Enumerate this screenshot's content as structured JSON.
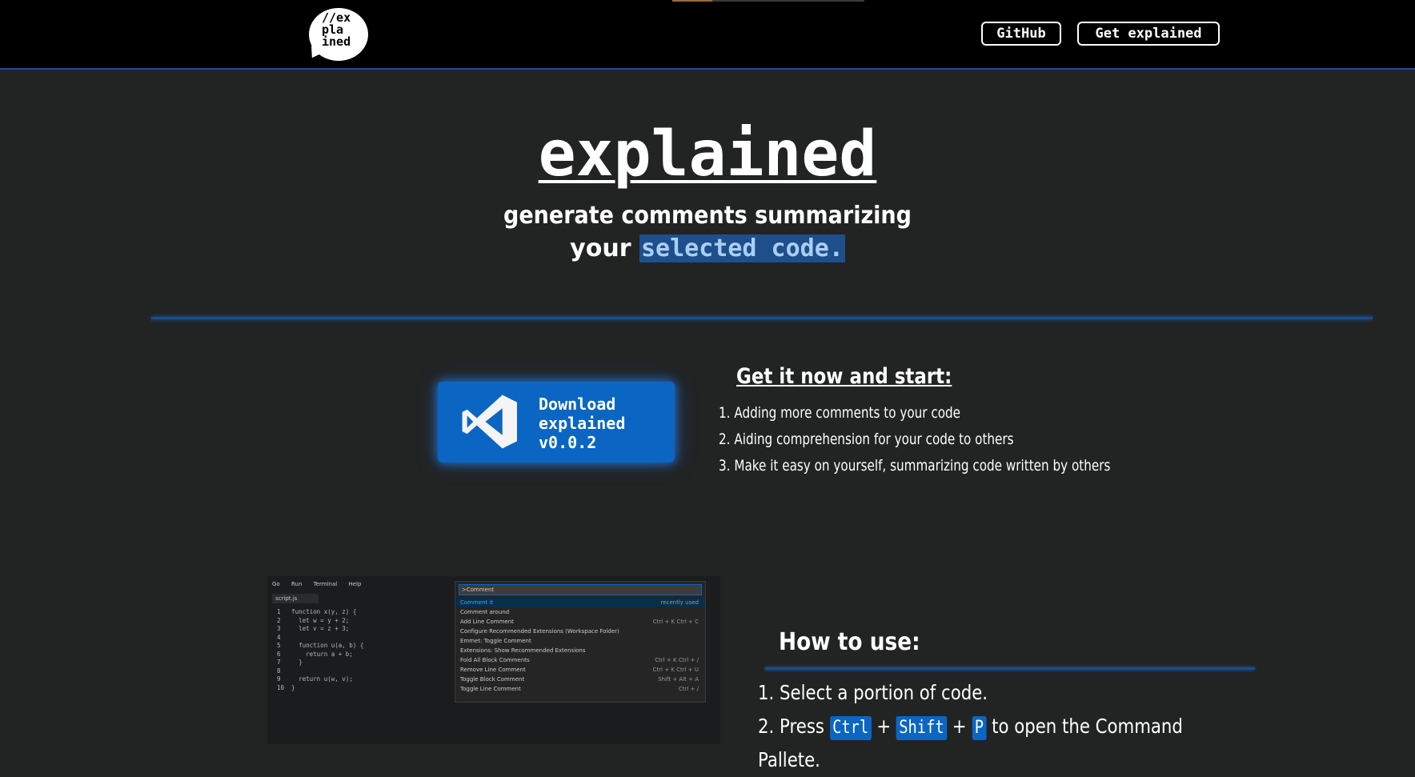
{
  "nav": {
    "logo_text": "//ex\npla\nined",
    "github_label": "GitHub",
    "get_explained_label": "Get explained"
  },
  "hero": {
    "title": "explained",
    "line1": "generate comments summarizing",
    "line2_prefix": "your",
    "line2_highlight": "selected code."
  },
  "download": {
    "icon": "vscode-icon",
    "line1": "Download",
    "line2": "explained",
    "line3": "v0.0.2"
  },
  "getit": {
    "title": "Get it now and start:",
    "items": [
      "1. Adding more comments to your code",
      "2. Aiding comprehension for your code to others",
      "3. Make it easy on yourself, summarizing code written by others"
    ]
  },
  "screenshot": {
    "menu": [
      "Go",
      "Run",
      "Terminal",
      "Help"
    ],
    "tab": "script.js",
    "code": "1   function x(y, z) {\n2     let w = y + 2;\n3     let v = z + 3;\n4\n5     function u(a, b) {\n6       return a + b;\n7     }\n8\n9     return u(w, v);\n10  }",
    "palette_input": ">Comment",
    "palette_items": [
      {
        "text": "Comment it",
        "keys": "recently used"
      },
      {
        "text": "Comment around",
        "keys": ""
      },
      {
        "text": "Add Line Comment",
        "keys": "Ctrl + K  Ctrl + C"
      },
      {
        "text": "Configure Recommended Extensions (Workspace Folder)",
        "keys": ""
      },
      {
        "text": "Emmet: Toggle Comment",
        "keys": ""
      },
      {
        "text": "Extensions: Show Recommended Extensions",
        "keys": ""
      },
      {
        "text": "Fold All Block Comments",
        "keys": "Ctrl + K  Ctrl + /"
      },
      {
        "text": "Remove Line Comment",
        "keys": "Ctrl + K  Ctrl + U"
      },
      {
        "text": "Toggle Block Comment",
        "keys": "Shift + Alt + A"
      },
      {
        "text": "Toggle Line Comment",
        "keys": "Ctrl + /"
      }
    ]
  },
  "howto": {
    "title": "How to use:",
    "step1": "1. Select a portion of code.",
    "step2_prefix": "2. Press",
    "key_ctrl": "Ctrl",
    "key_shift": "Shift",
    "key_p": "P",
    "plus": "+",
    "step2_suffix": "to open the Command Pallete."
  }
}
